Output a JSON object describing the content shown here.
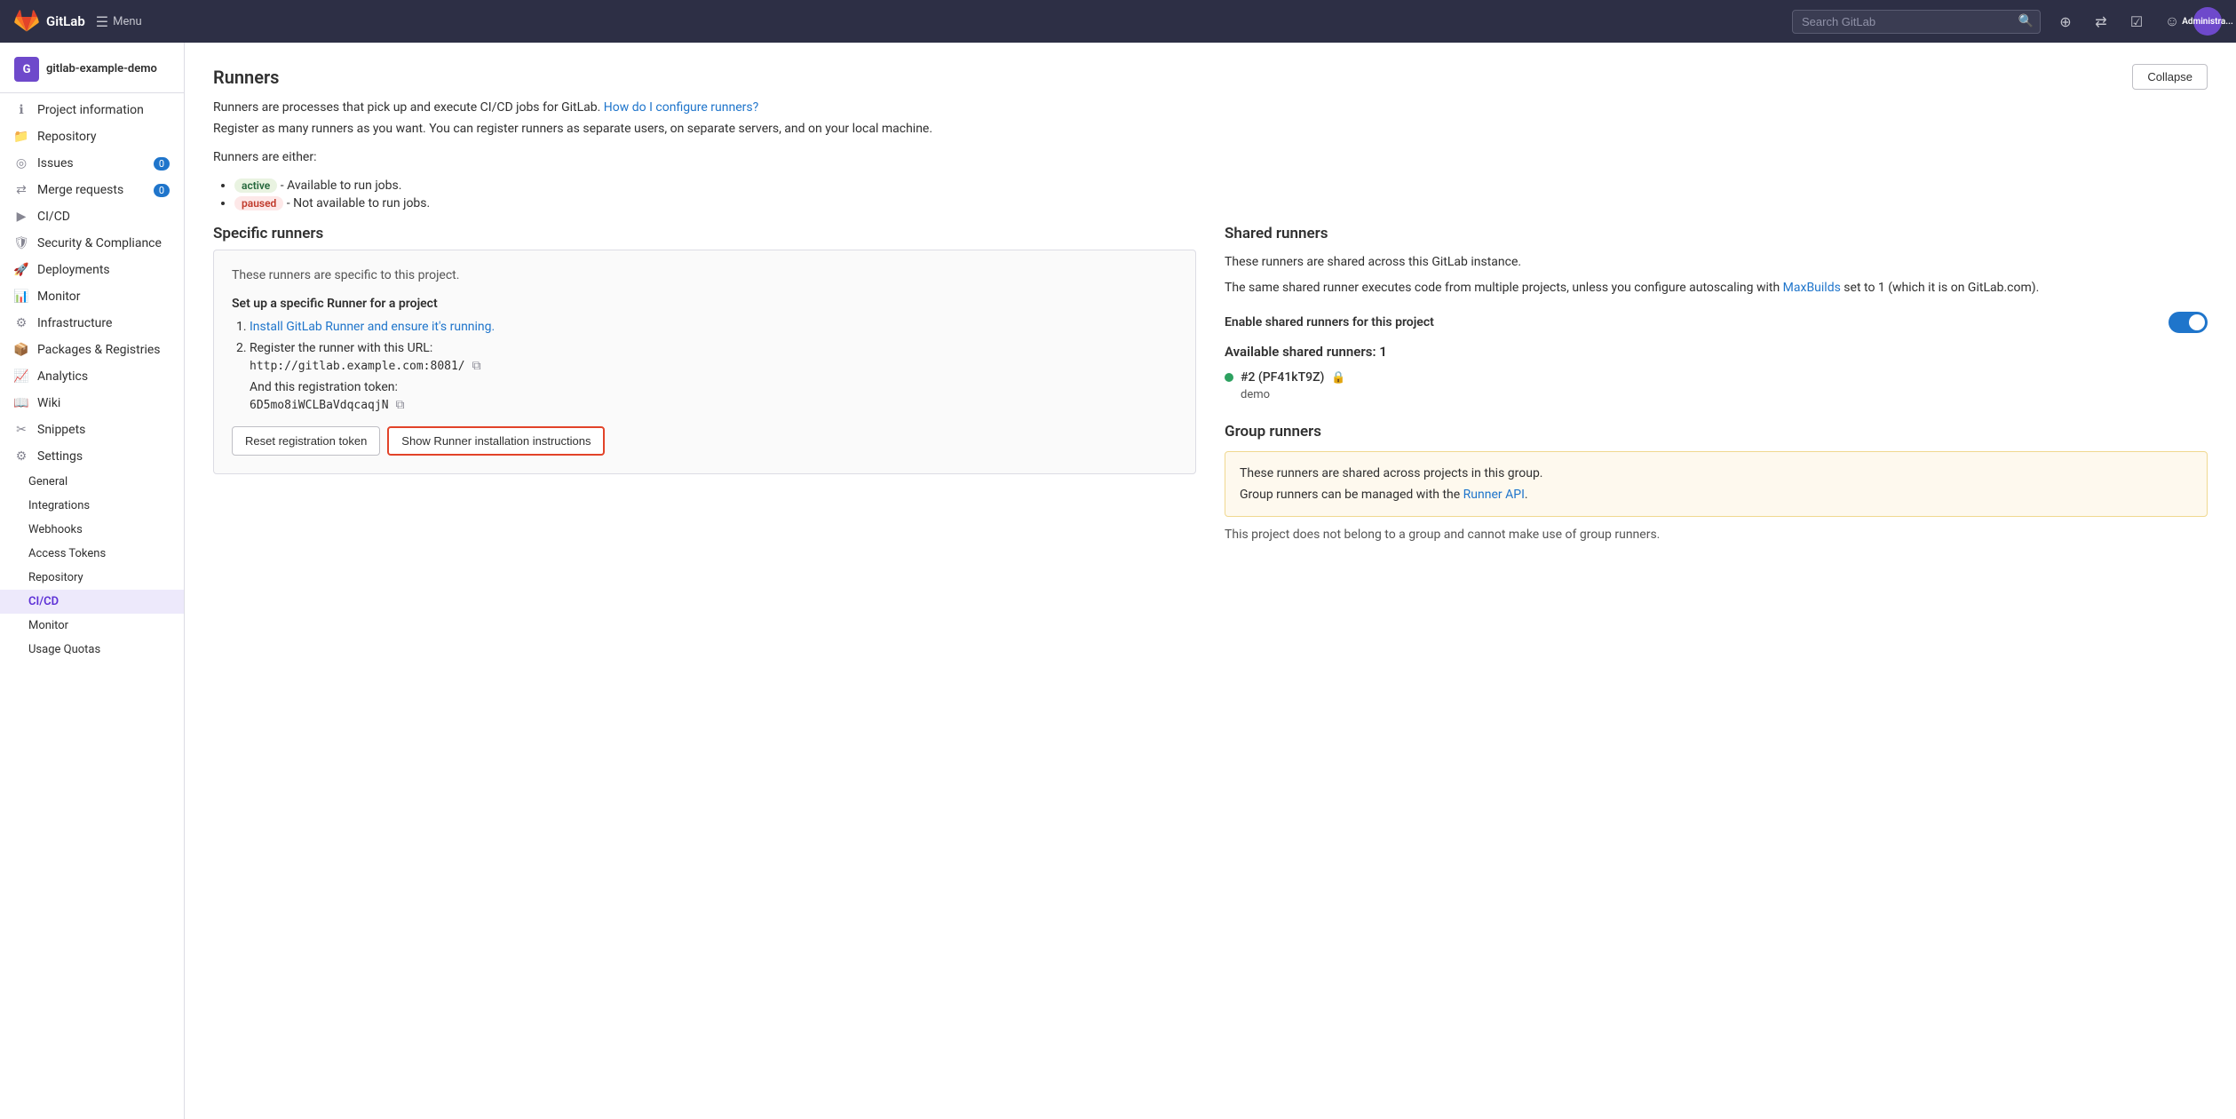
{
  "topnav": {
    "logo_text": "GitLab",
    "menu_label": "Menu",
    "search_placeholder": "Search GitLab",
    "admin_label": "Administra..."
  },
  "sidebar": {
    "project_initial": "G",
    "project_name": "gitlab-example-demo",
    "items": [
      {
        "id": "project-information",
        "label": "Project information",
        "icon": "info-icon"
      },
      {
        "id": "repository",
        "label": "Repository",
        "icon": "repo-icon"
      },
      {
        "id": "issues",
        "label": "Issues",
        "icon": "issues-icon",
        "badge": "0"
      },
      {
        "id": "merge-requests",
        "label": "Merge requests",
        "icon": "merge-icon",
        "badge": "0"
      },
      {
        "id": "cicd",
        "label": "CI/CD",
        "icon": "cicd-icon"
      },
      {
        "id": "security-compliance",
        "label": "Security & Compliance",
        "icon": "security-icon"
      },
      {
        "id": "deployments",
        "label": "Deployments",
        "icon": "deployments-icon"
      },
      {
        "id": "monitor",
        "label": "Monitor",
        "icon": "monitor-icon"
      },
      {
        "id": "infrastructure",
        "label": "Infrastructure",
        "icon": "infra-icon"
      },
      {
        "id": "packages-registries",
        "label": "Packages & Registries",
        "icon": "packages-icon"
      },
      {
        "id": "analytics",
        "label": "Analytics",
        "icon": "analytics-icon"
      },
      {
        "id": "wiki",
        "label": "Wiki",
        "icon": "wiki-icon"
      },
      {
        "id": "snippets",
        "label": "Snippets",
        "icon": "snippets-icon"
      },
      {
        "id": "settings",
        "label": "Settings",
        "icon": "settings-icon"
      }
    ],
    "settings_subitems": [
      {
        "id": "general",
        "label": "General"
      },
      {
        "id": "integrations",
        "label": "Integrations"
      },
      {
        "id": "webhooks",
        "label": "Webhooks"
      },
      {
        "id": "access-tokens",
        "label": "Access Tokens"
      },
      {
        "id": "repository-settings",
        "label": "Repository"
      },
      {
        "id": "cicd-settings",
        "label": "CI/CD",
        "active": true
      },
      {
        "id": "monitor-settings",
        "label": "Monitor"
      },
      {
        "id": "usage-quotas",
        "label": "Usage Quotas"
      }
    ]
  },
  "main": {
    "runners_section": {
      "title": "Runners",
      "collapse_label": "Collapse",
      "description": "Runners are processes that pick up and execute CI/CD jobs for GitLab.",
      "how_to_link": "How do I configure runners?",
      "register_text": "Register as many runners as you want. You can register runners as separate users, on separate servers, and on your local machine.",
      "runners_are_either": "Runners are either:",
      "active_badge": "active",
      "active_desc": "- Available to run jobs.",
      "paused_badge": "paused",
      "paused_desc": "- Not available to run jobs.",
      "specific_runners": {
        "title": "Specific runners",
        "description": "These runners are specific to this project.",
        "setup_title": "Set up a specific Runner for a project",
        "step1_link": "Install GitLab Runner and ensure it's running.",
        "step2_label": "Register the runner with this URL:",
        "url": "http://gitlab.example.com:8081/",
        "token_label": "And this registration token:",
        "token": "6D5mo8iWCLBaVdqcaqjN",
        "reset_btn": "Reset registration token",
        "show_instructions_btn": "Show Runner installation instructions"
      },
      "shared_runners": {
        "title": "Shared runners",
        "desc1": "These runners are shared across this GitLab instance.",
        "desc2": "The same shared runner executes code from multiple projects, unless you configure autoscaling with",
        "maxbuilds_link": "MaxBuilds",
        "desc3": "set to 1 (which it is on GitLab.com).",
        "enable_label": "Enable shared runners for this project",
        "toggle_on": true,
        "available_title": "Available shared runners: 1",
        "runner_name": "#2 (PF41kT9Z)",
        "runner_label": "demo"
      },
      "group_runners": {
        "title": "Group runners",
        "box_text1": "These runners are shared across projects in this group.",
        "box_text2": "Group runners can be managed with the",
        "runner_api_link": "Runner API",
        "note": "This project does not belong to a group and cannot make use of group runners."
      }
    }
  }
}
